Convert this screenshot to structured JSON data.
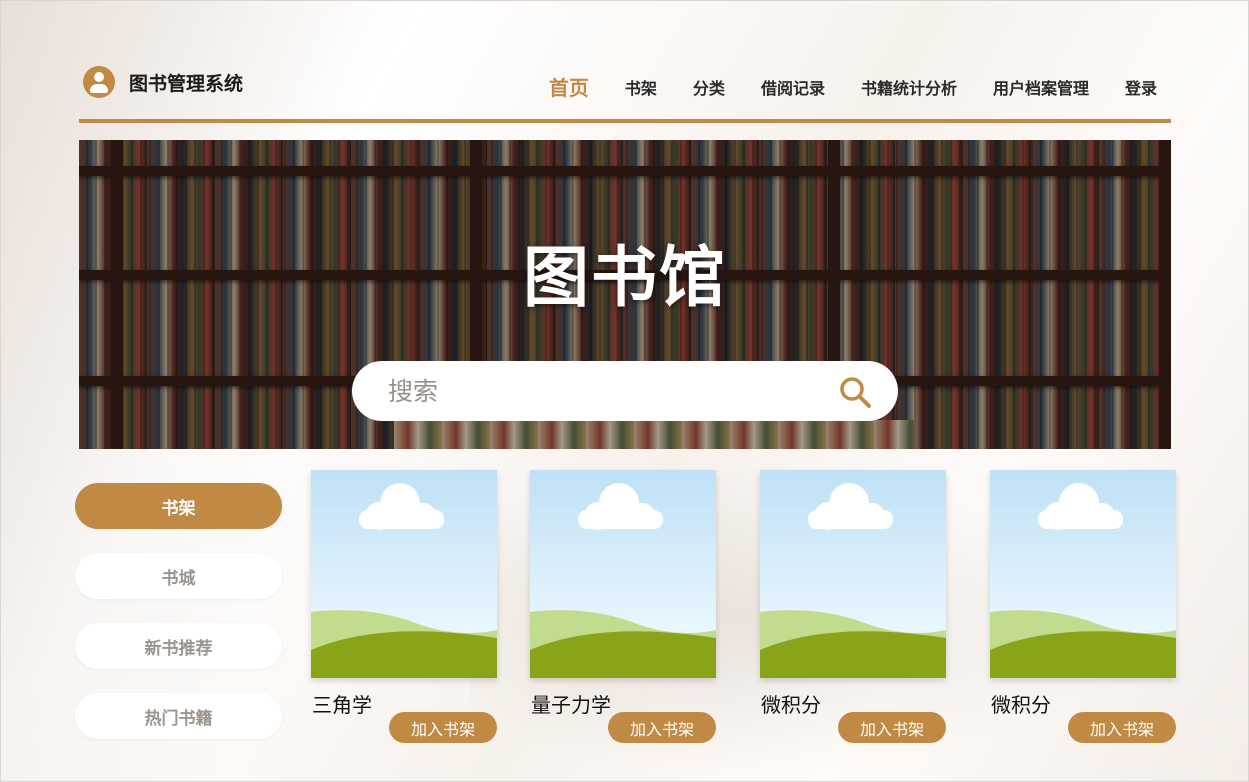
{
  "app": {
    "title": "图书管理系统",
    "brand_icon": "user-circle-icon",
    "accent_color": "#c08a45"
  },
  "nav": {
    "items": [
      {
        "label": "首页",
        "active": true
      },
      {
        "label": "书架",
        "active": false
      },
      {
        "label": "分类",
        "active": false
      },
      {
        "label": "借阅记录",
        "active": false
      },
      {
        "label": "书籍统计分析",
        "active": false
      },
      {
        "label": "用户档案管理",
        "active": false
      },
      {
        "label": "登录",
        "active": false
      }
    ]
  },
  "hero": {
    "title": "图书馆",
    "search": {
      "placeholder": "搜索",
      "value": "",
      "icon": "search-icon"
    }
  },
  "side_menu": {
    "items": [
      {
        "label": "书架",
        "active": true
      },
      {
        "label": "书城",
        "active": false
      },
      {
        "label": "新书推荐",
        "active": false
      },
      {
        "label": "热门书籍",
        "active": false
      }
    ]
  },
  "books": [
    {
      "title": "三角学",
      "action_label": "加入书架",
      "cover": "placeholder-landscape-icon"
    },
    {
      "title": "量子力学",
      "action_label": "加入书架",
      "cover": "placeholder-landscape-icon"
    },
    {
      "title": "微积分",
      "action_label": "加入书架",
      "cover": "placeholder-landscape-icon"
    },
    {
      "title": "微积分",
      "action_label": "加入书架",
      "cover": "placeholder-landscape-icon"
    }
  ]
}
